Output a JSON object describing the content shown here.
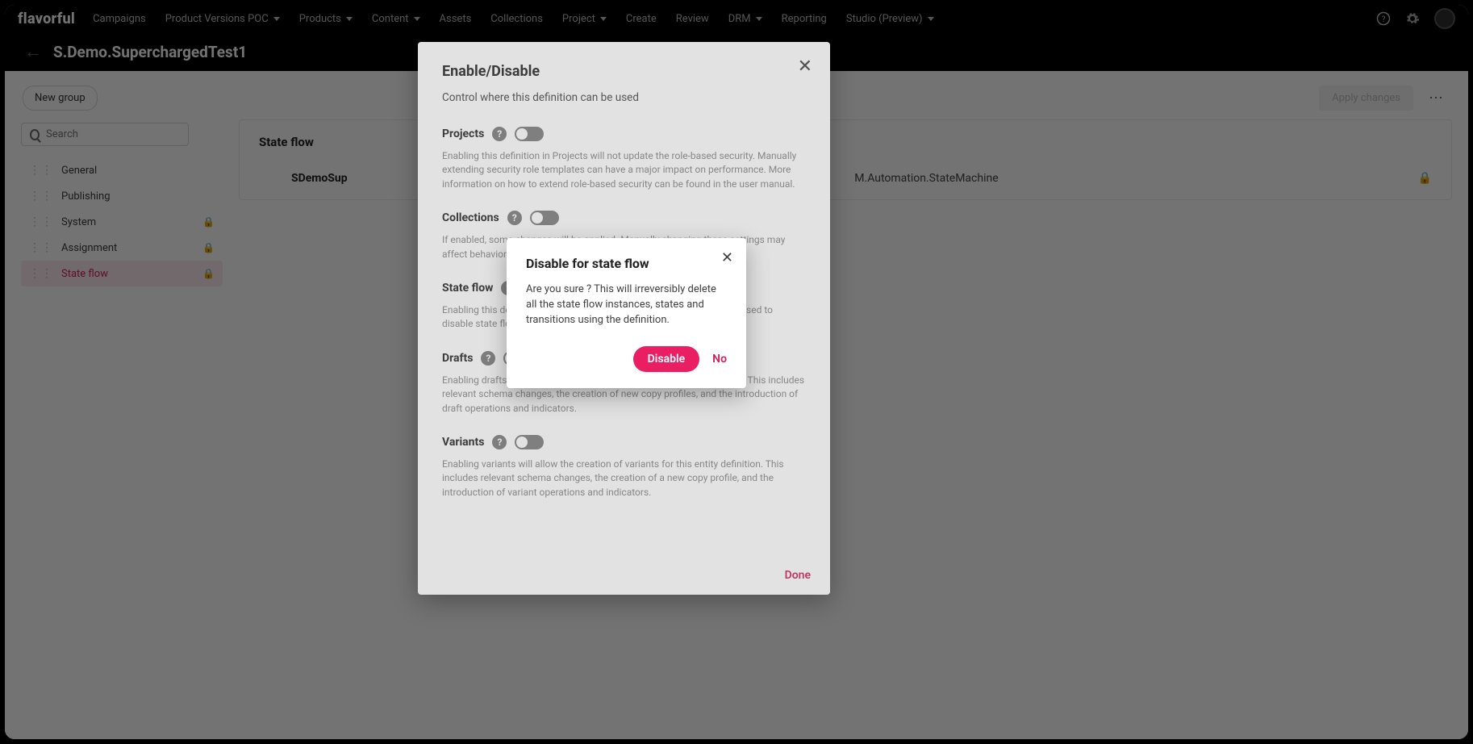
{
  "brand": "flavorful",
  "nav": [
    {
      "label": "Campaigns",
      "caret": false
    },
    {
      "label": "Product Versions POC",
      "caret": true
    },
    {
      "label": "Products",
      "caret": true
    },
    {
      "label": "Content",
      "caret": true
    },
    {
      "label": "Assets",
      "caret": false
    },
    {
      "label": "Collections",
      "caret": false
    },
    {
      "label": "Project",
      "caret": true
    },
    {
      "label": "Create",
      "caret": false
    },
    {
      "label": "Review",
      "caret": false
    },
    {
      "label": "DRM",
      "caret": true
    },
    {
      "label": "Reporting",
      "caret": false
    },
    {
      "label": "Studio (Preview)",
      "caret": true
    }
  ],
  "page_title": "S.Demo.SuperchargedTest1",
  "toolbar": {
    "new_group": "New group",
    "apply_changes": "Apply changes"
  },
  "search_placeholder": "Search",
  "sidebar": [
    {
      "label": "General",
      "locked": false,
      "active": false
    },
    {
      "label": "Publishing",
      "locked": false,
      "active": false
    },
    {
      "label": "System",
      "locked": true,
      "active": false
    },
    {
      "label": "Assignment",
      "locked": true,
      "active": false
    },
    {
      "label": "State flow",
      "locked": true,
      "active": true
    }
  ],
  "panel": {
    "heading": "State flow",
    "def_name": "SDemoSup",
    "def_path": "M.Automation.StateMachine"
  },
  "modal1": {
    "title": "Enable/Disable",
    "subtitle": "Control where this definition can be used",
    "done": "Done",
    "sections": [
      {
        "label": "Projects",
        "on": false,
        "desc": "Enabling this definition in Projects will not update the role-based security. Manually extending security role templates can have a major impact on performance. More information on how to extend role-based security can be found in the user manual."
      },
      {
        "label": "Collections",
        "on": false,
        "desc": "If enabled, some changes will be applied. Manually changing these settings may affect behavior."
      },
      {
        "label": "State flow",
        "on": true,
        "desc": "Enabling this definition for state flow components.\nBeware! It's not advised to disable state flow since state flow actions may induce a big change."
      },
      {
        "label": "Drafts",
        "on": false,
        "desc": "Enabling drafts will allow the creation of drafts for this entity definition. This includes relevant schema changes, the creation of new copy profiles, and the introduction of draft operations and indicators."
      },
      {
        "label": "Variants",
        "on": false,
        "desc": "Enabling variants will allow the creation of variants for this entity definition. This includes relevant schema changes, the creation of a new copy profile, and the introduction of variant operations and indicators."
      }
    ]
  },
  "modal2": {
    "title": "Disable for state flow",
    "body": "Are you sure ? This will irreversibly delete all the state flow instances, states and transitions using the definition.",
    "primary": "Disable",
    "secondary": "No"
  }
}
